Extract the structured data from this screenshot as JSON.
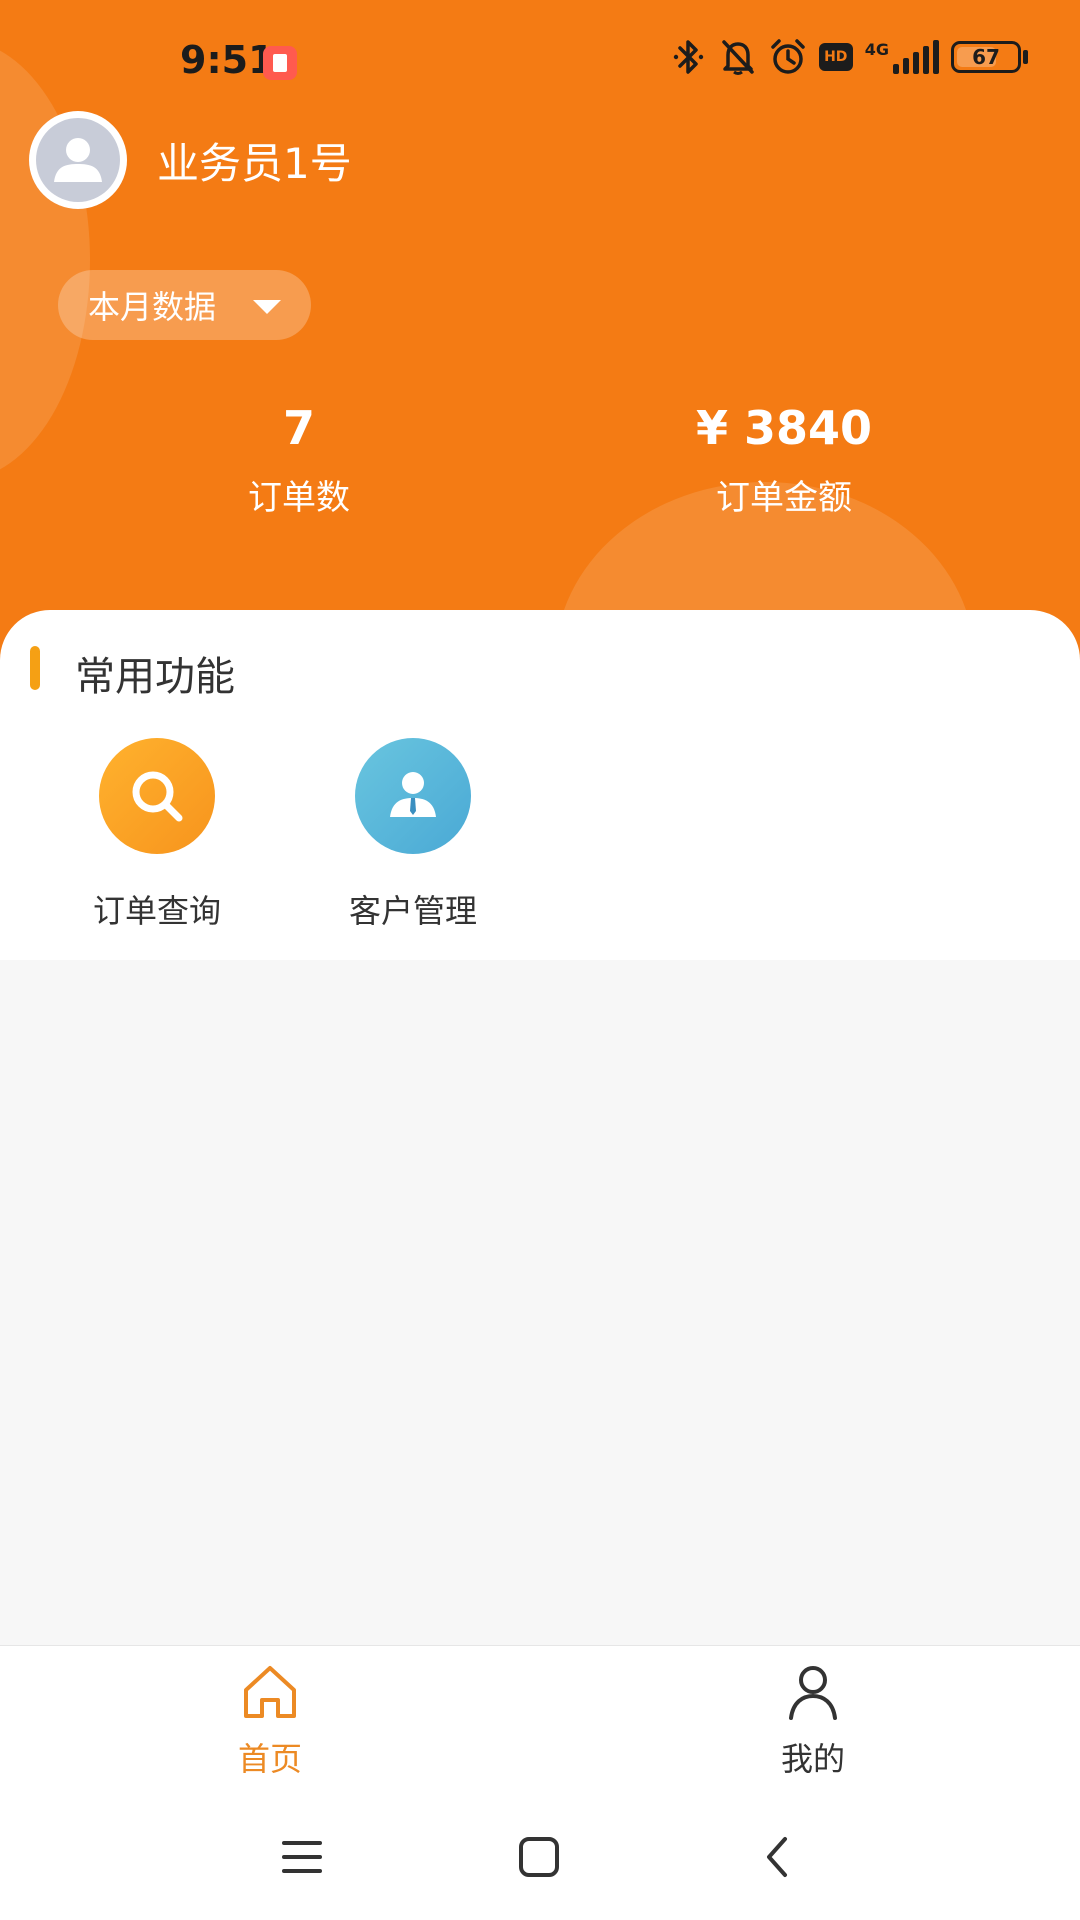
{
  "status_bar": {
    "time": "9:51",
    "network": "4G",
    "battery": "67",
    "battery_level": 0.67,
    "hd": "HD",
    "icons": [
      "bluetooth-icon",
      "mute-bell-icon",
      "alarm-icon",
      "hd-icon",
      "signal-icon",
      "battery-icon"
    ]
  },
  "profile": {
    "name": "业务员1号"
  },
  "period": {
    "selected": "本月数据"
  },
  "stats": {
    "orders": {
      "value": "7",
      "label": "订单数"
    },
    "amount": {
      "value": "¥ 3840",
      "label": "订单金额"
    }
  },
  "functions": {
    "title": "常用功能",
    "items": [
      {
        "label": "订单查询",
        "icon": "search-icon"
      },
      {
        "label": "客户管理",
        "icon": "customer-icon"
      }
    ]
  },
  "tabs": [
    {
      "label": "首页",
      "icon": "home-icon",
      "active": true
    },
    {
      "label": "我的",
      "icon": "user-icon",
      "active": false
    }
  ],
  "colors": {
    "header": "#f47b14",
    "accent": "#f5a014",
    "active_tab": "#ec8a24",
    "customer_icon": "#4aa9d5"
  }
}
